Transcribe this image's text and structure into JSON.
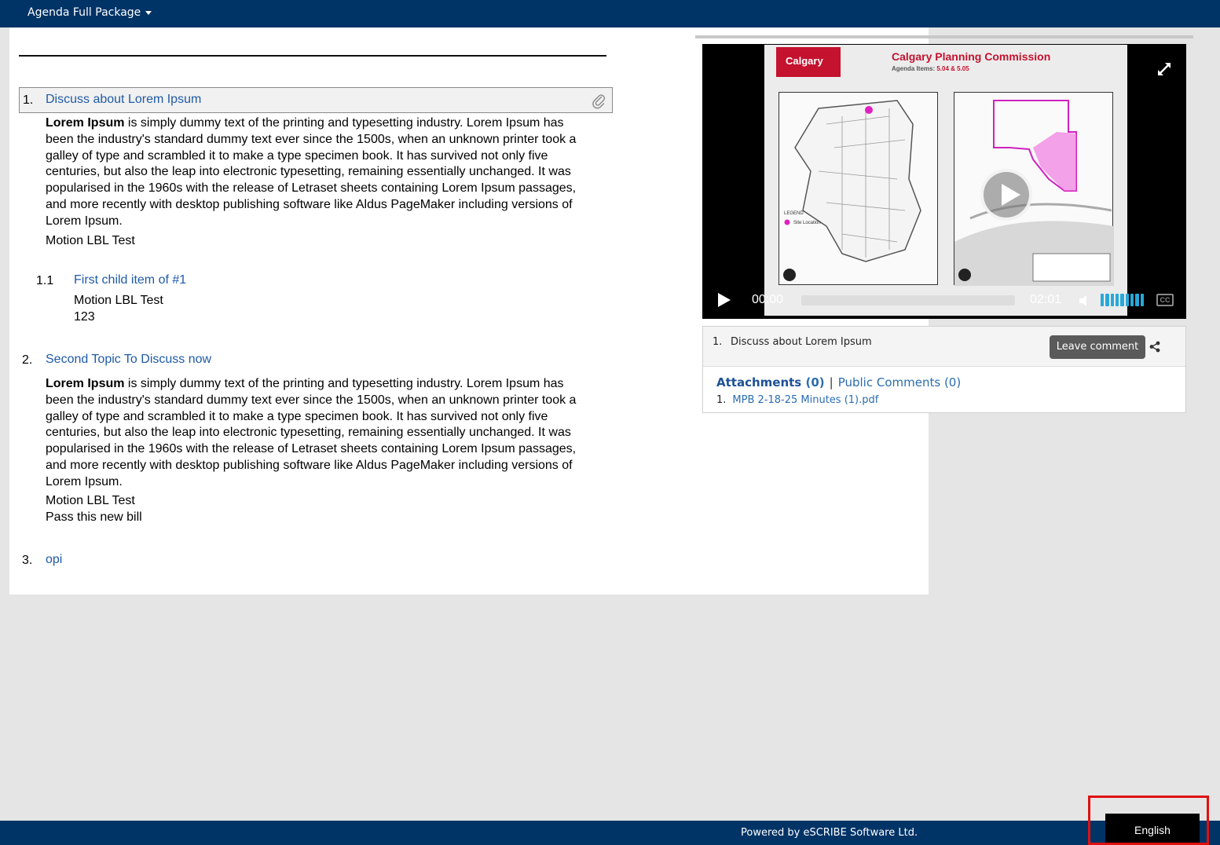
{
  "header": {
    "package_menu_label": "Agenda Full Package"
  },
  "agenda": {
    "items": [
      {
        "number": "1.",
        "title": "Discuss about Lorem Ipsum",
        "body_bold": "Lorem Ipsum",
        "body_lines": [
          " is simply dummy text of the printing and typesetting industry. Lorem Ipsum has",
          "been the industry's standard dummy text ever since the 1500s, when an unknown printer took a",
          "galley of type and scrambled it to make a type specimen book. It has survived not only five",
          "centuries, but also the leap into electronic typesetting, remaining essentially unchanged. It was",
          "popularised in the 1960s with the release of Letraset sheets containing Lorem Ipsum passages,",
          "and more recently with desktop publishing software like Aldus PageMaker including versions of",
          "Lorem Ipsum."
        ],
        "extra_lines": [
          "Motion LBL Test"
        ]
      },
      {
        "number": "2.",
        "title": "Second Topic To Discuss now",
        "body_bold": "Lorem Ipsum",
        "body_lines": [
          " is simply dummy text of the printing and typesetting industry. Lorem Ipsum has",
          "been the industry's standard dummy text ever since the 1500s, when an unknown printer took a",
          "galley of type and scrambled it to make a type specimen book. It has survived not only five",
          "centuries, but also the leap into electronic typesetting, remaining essentially unchanged. It was",
          "popularised in the 1960s with the release of Letraset sheets containing Lorem Ipsum passages,",
          "and more recently with desktop publishing software like Aldus PageMaker including versions of",
          "Lorem Ipsum."
        ],
        "extra_lines": [
          "Motion LBL Test",
          "Pass this new bill"
        ]
      },
      {
        "number": "3.",
        "title": "opi"
      }
    ],
    "child_item": {
      "number": "1.1",
      "title": "First child item of #1",
      "lines": [
        "Motion LBL Test",
        "123"
      ]
    }
  },
  "video": {
    "slide_logo": "Calgary",
    "slide_title": "Calgary Planning Commission",
    "slide_subtitle_prefix": "Agenda Items: ",
    "slide_subtitle_items": "5.04 & 5.05",
    "current_time": "00:00",
    "duration": "02:01",
    "progress": 0.0,
    "volume": 1.0,
    "cc_label": "CC"
  },
  "info_panel": {
    "item_number": "1.",
    "item_title": "Discuss about Lorem Ipsum",
    "leave_comment_label": "Leave comment",
    "attachments_label": "Attachments",
    "attachments_count": "(0)",
    "separator": "|",
    "public_comments_label": "Public Comments",
    "public_comments_count": "(0)",
    "files": [
      {
        "number": "1.",
        "name": "MPB 2-18-25 Minutes (1).pdf"
      }
    ]
  },
  "footer": {
    "powered_by": "Powered by eSCRIBE Software Ltd.",
    "language_label": "English"
  },
  "colors": {
    "navy": "#003366",
    "link_blue": "#1f5aa6",
    "highlight_red": "#e01010",
    "volume_blue": "#29a8d8"
  }
}
